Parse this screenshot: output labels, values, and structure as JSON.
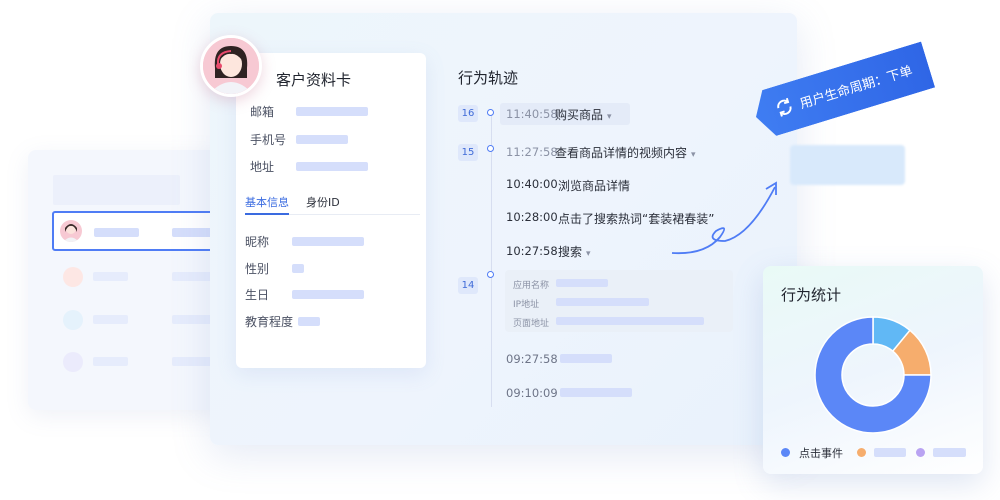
{
  "profile_card": {
    "title": "客户资料卡",
    "fields": [
      "邮箱",
      "手机号",
      "地址"
    ],
    "tabs": [
      "基本信息",
      "身份ID"
    ],
    "basic_fields": [
      "昵称",
      "性别",
      "生日",
      "教育程度"
    ]
  },
  "timeline": {
    "title": "行为轨迹",
    "groups": [
      {
        "badge": "16",
        "time": "11:40:58",
        "text": "购买商品"
      },
      {
        "badge": "15",
        "time": "11:27:58",
        "text": "查看商品详情的视频内容"
      }
    ],
    "events": [
      {
        "time": "10:40:00",
        "text": "浏览商品详情"
      },
      {
        "time": "10:28:00",
        "text": "点击了搜索热词“套装裙春装”"
      },
      {
        "time": "10:27:58",
        "text": "搜索"
      }
    ],
    "group3": {
      "badge": "14",
      "detail_labels": [
        "应用名称",
        "IP地址",
        "页面地址"
      ]
    },
    "later_times": [
      "09:27:58",
      "09:10:09"
    ]
  },
  "lifecycle_tag": {
    "label": "用户生命周期：下单",
    "icon": "refresh-icon"
  },
  "stats": {
    "title": "行为统计",
    "legend_first": "点击事件",
    "colors": {
      "blue": "#5b87f7",
      "orange": "#f6ad6d",
      "purple": "#b9a3f2"
    }
  },
  "chart_data": {
    "type": "pie",
    "values": [
      75,
      14,
      11
    ],
    "colors": [
      "#5b87f7",
      "#f6ad6d",
      "#61b8f5"
    ]
  }
}
